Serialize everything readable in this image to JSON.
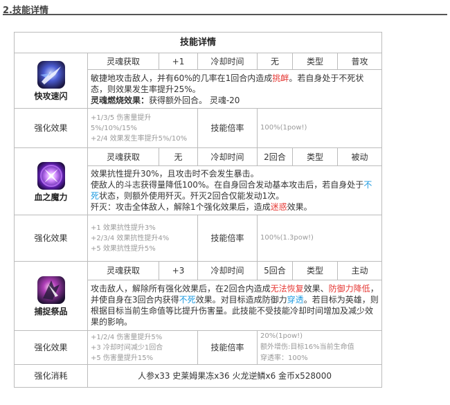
{
  "section_title": "2.技能详情",
  "table_title": "技能详情",
  "labels": {
    "soul_gain": "灵魂获取",
    "cooldown": "冷却时间",
    "type": "类型",
    "enhance": "强化效果",
    "multiplier": "技能倍率",
    "cost": "强化消耗"
  },
  "skills": [
    {
      "name": "快攻速闪",
      "icon": "swift-strike-icon",
      "soul": "+1",
      "cooldown": "无",
      "type": "普攻",
      "desc": [
        [
          {
            "t": "敏捷地攻击敌人，并有60%的几率在1回合内造成"
          },
          {
            "t": "挑衅",
            "c": "red"
          },
          {
            "t": "。若自身处于不死状态，则效果发生率提升25%。"
          }
        ],
        [
          {
            "t": "灵魂燃烧效果：",
            "b": true
          },
          {
            "t": "获得额外回合。 灵魂-20"
          }
        ]
      ],
      "enhance": [
        "+1/3/5 伤害量提升5%/10%/15%",
        "+2/4 效果发生率提升5%/10%"
      ],
      "multiplier": [
        "100%(1pow!)"
      ]
    },
    {
      "name": "血之魔力",
      "icon": "blood-magic-icon",
      "soul": "无",
      "cooldown": "2回合",
      "type": "被动",
      "desc": [
        [
          {
            "t": "效果抗性提升30%，且攻击时不会发生暴击。"
          }
        ],
        [
          {
            "t": "使敌人的斗志获得量降低100%。在自身回合发动基本攻击后，若自身处于"
          },
          {
            "t": "不死",
            "c": "blue"
          },
          {
            "t": "状态，则额外使用歼灭。歼灭2回合仅能发动1次。"
          }
        ],
        [
          {
            "t": "歼灭：攻击全体敌人，解除1个强化效果后，造成"
          },
          {
            "t": "迷惑",
            "c": "red"
          },
          {
            "t": "效果。"
          }
        ]
      ],
      "enhance": [
        "+1 效果抗性提升3%",
        "+2/3/4  效果抗性提升4%",
        "+5 效果抗性提升5%"
      ],
      "multiplier": [
        "100%(1.3pow!)"
      ]
    },
    {
      "name": "捕捉祭品",
      "icon": "capture-sacrifice-icon",
      "soul": "+3",
      "cooldown": "5回合",
      "type": "主动",
      "desc": [
        [
          {
            "t": "攻击敌人，解除所有强化效果后，在2回合内造成"
          },
          {
            "t": "无法恢复",
            "c": "red"
          },
          {
            "t": "效果、"
          },
          {
            "t": "防御力降低",
            "c": "red"
          },
          {
            "t": "，并使自身在3回合内获得"
          },
          {
            "t": "不死",
            "c": "blue"
          },
          {
            "t": "效果。对目标造成防御力"
          },
          {
            "t": "穿透",
            "c": "blue"
          },
          {
            "t": "。若目标为英雄，则根据目标当前生命值等比提升伤害量。此技能不受技能冷却时间增加及减少效果的影响。"
          }
        ]
      ],
      "enhance": [
        "+1/2/4 伤害量提升5%",
        "+3 冷却时间减少1回合",
        "+5 伤害量提升15%"
      ],
      "multiplier": [
        "20%(1pow!)",
        "额外增伤:目标16%当前生命值",
        "穿透率：100%"
      ]
    }
  ],
  "cost": "人参x33  史莱姆果冻x36 火龙逆鳞x6 金币x528000",
  "colors": {
    "red": "#e53935",
    "blue": "#1e9be0",
    "border": "#bbbbbb"
  }
}
